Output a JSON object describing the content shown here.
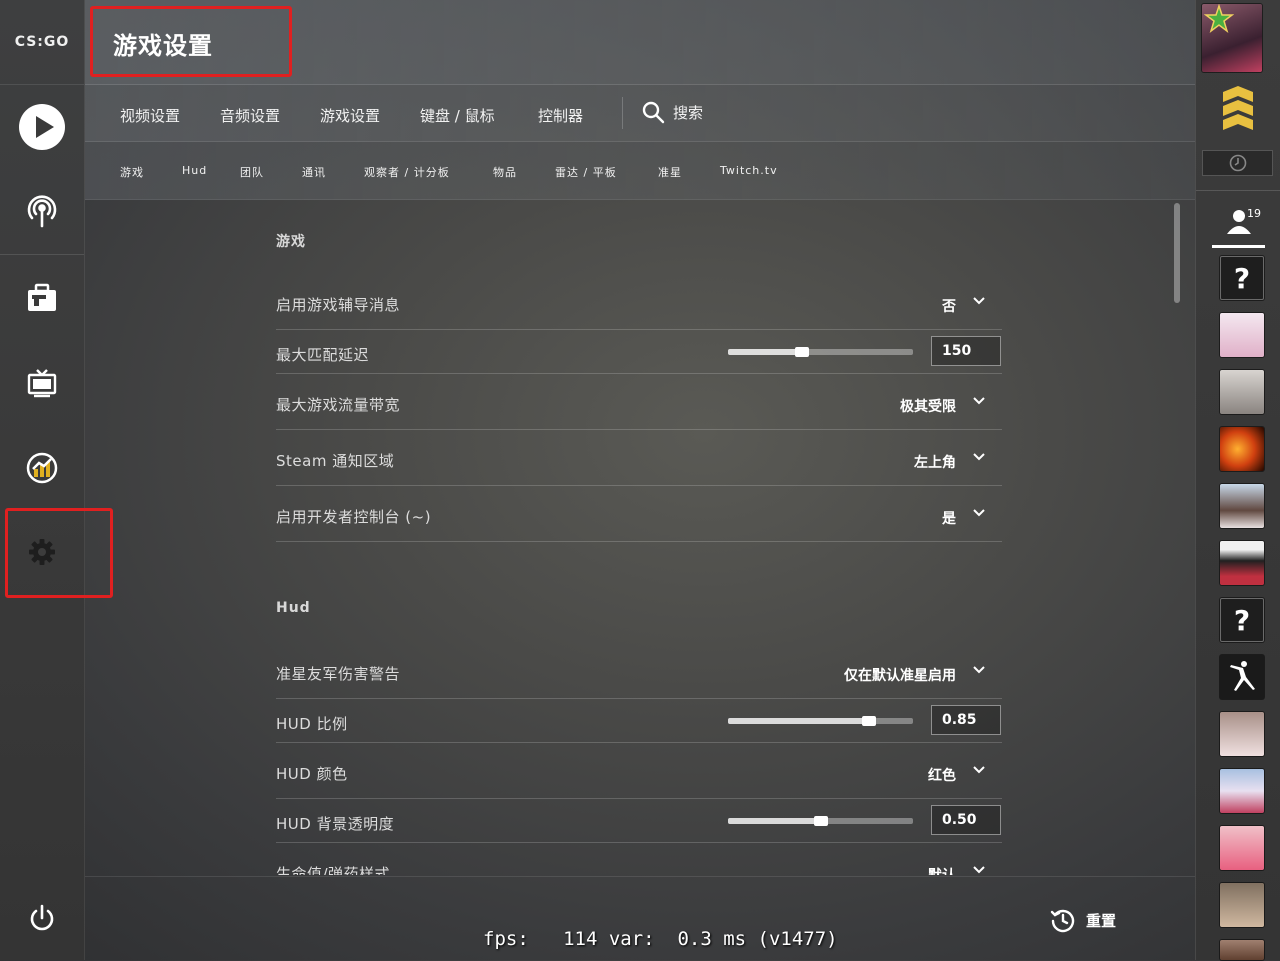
{
  "app": {
    "logo_text": "CS:GO"
  },
  "header": {
    "title": "游戏设置"
  },
  "main_tabs": [
    {
      "label": "视频设置"
    },
    {
      "label": "音频设置"
    },
    {
      "label": "游戏设置"
    },
    {
      "label": "键盘 / 鼠标"
    },
    {
      "label": "控制器"
    }
  ],
  "search": {
    "label": "搜索"
  },
  "sub_tabs": [
    {
      "label": "游戏"
    },
    {
      "label": "Hud"
    },
    {
      "label": "团队"
    },
    {
      "label": "通讯"
    },
    {
      "label": "观察者 / 计分板"
    },
    {
      "label": "物品"
    },
    {
      "label": "雷达 / 平板"
    },
    {
      "label": "准星"
    },
    {
      "label": "Twitch.tv"
    }
  ],
  "sections": {
    "game": {
      "title": "游戏",
      "rows": [
        {
          "label": "启用游戏辅导消息",
          "value": "否"
        },
        {
          "label": "最大匹配延迟",
          "value": "150",
          "slider": 0.4
        },
        {
          "label": "最大游戏流量带宽",
          "value": "极其受限"
        },
        {
          "label": "Steam 通知区域",
          "value": "左上角"
        },
        {
          "label": "启用开发者控制台 (~)",
          "value": "是"
        }
      ]
    },
    "hud": {
      "title": "Hud",
      "rows": [
        {
          "label": "准星友军伤害警告",
          "value": "仅在默认准星启用"
        },
        {
          "label": "HUD 比例",
          "value": "0.85",
          "slider": 0.76
        },
        {
          "label": "HUD 颜色",
          "value": "红色"
        },
        {
          "label": "HUD 背景透明度",
          "value": "0.50",
          "slider": 0.5
        },
        {
          "label": "生命值/弹药样式",
          "value": "默认"
        }
      ]
    }
  },
  "footer": {
    "reset_label": "重置",
    "fps_text": "fps:   114 var:  0.3 ms (v1477)"
  },
  "friends": {
    "count": "19"
  },
  "colors": {
    "highlight_box": "#e02020",
    "accent": "#ffffff"
  }
}
